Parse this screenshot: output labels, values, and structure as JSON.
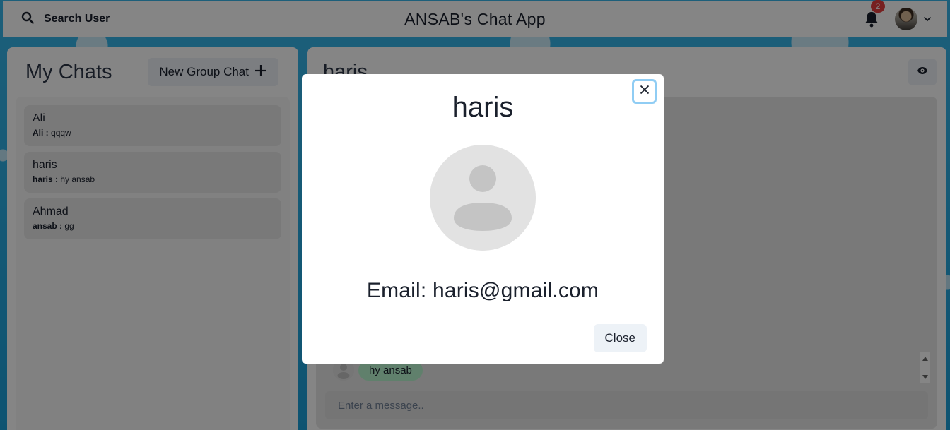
{
  "topbar": {
    "search_label": "Search User",
    "app_title": "ANSAB's Chat App",
    "notification_count": "2"
  },
  "sidebar": {
    "title": "My Chats",
    "new_group_label": "New Group Chat",
    "chats": [
      {
        "name": "Ali",
        "sender": "Ali :",
        "message": "qqqw"
      },
      {
        "name": "haris",
        "sender": "haris :",
        "message": "hy ansab"
      },
      {
        "name": "Ahmad",
        "sender": "ansab :",
        "message": "gg"
      }
    ]
  },
  "chatbox": {
    "title": "haris",
    "message": "hy ansab",
    "input_placeholder": "Enter a message.."
  },
  "modal": {
    "title": "haris",
    "email": "Email: haris@gmail.com",
    "close_label": "Close"
  },
  "colors": {
    "accent_blue": "#1da1d9",
    "badge_red": "#e53e3e",
    "bubble_green": "#b9f5d0",
    "focus_ring": "#90cdf4"
  }
}
